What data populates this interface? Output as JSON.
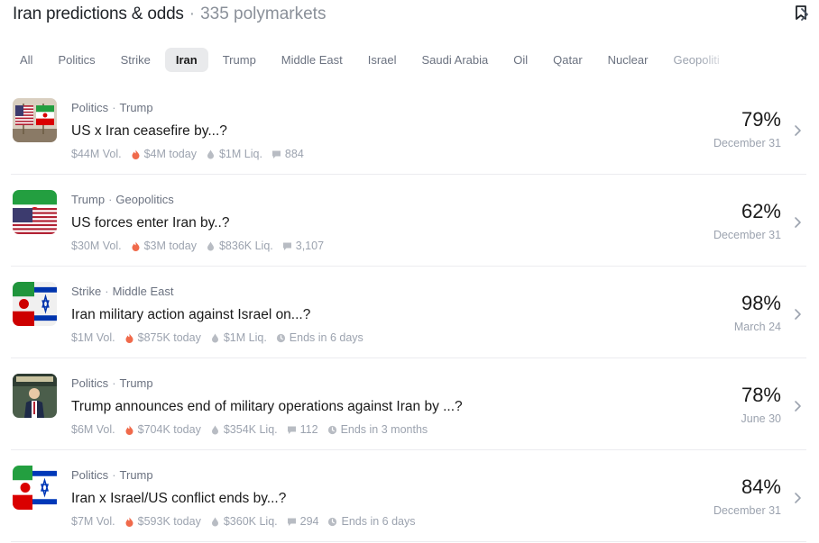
{
  "header": {
    "title": "Iran predictions & odds",
    "separator": "·",
    "count": "335 polymarkets"
  },
  "filters": [
    "All",
    "Politics",
    "Strike",
    "Iran",
    "Trump",
    "Middle East",
    "Israel",
    "Saudi Arabia",
    "Oil",
    "Qatar",
    "Nuclear",
    "Geopoliti"
  ],
  "active_filter": "Iran",
  "markets": [
    {
      "cat1": "Politics",
      "cat2": "Trump",
      "question": "US x Iran ceasefire by...?",
      "vol": "$44M Vol.",
      "today": "$4M today",
      "liq": "$1M Liq.",
      "comments": "884",
      "ends": "",
      "percent": "79%",
      "date": "December 31",
      "thumb": "us-iran-flags"
    },
    {
      "cat1": "Trump",
      "cat2": "Geopolitics",
      "question": "US forces enter Iran by..?",
      "vol": "$30M Vol.",
      "today": "$3M today",
      "liq": "$836K Liq.",
      "comments": "3,107",
      "ends": "",
      "percent": "62%",
      "date": "December 31",
      "thumb": "us-iran-split-flags"
    },
    {
      "cat1": "Strike",
      "cat2": "Middle East",
      "question": "Iran military action against Israel on...?",
      "vol": "$1M Vol.",
      "today": "$875K today",
      "liq": "$1M Liq.",
      "comments": "",
      "ends": "Ends in 6 days",
      "percent": "98%",
      "date": "March 24",
      "thumb": "iran-israel-flags"
    },
    {
      "cat1": "Politics",
      "cat2": "Trump",
      "question": "Trump announces end of military operations against Iran by ...?",
      "vol": "$6M Vol.",
      "today": "$704K today",
      "liq": "$354K Liq.",
      "comments": "112",
      "ends": "Ends in 3 months",
      "percent": "78%",
      "date": "June 30",
      "thumb": "trump-podium"
    },
    {
      "cat1": "Politics",
      "cat2": "Trump",
      "question": "Iran x Israel/US conflict ends by...?",
      "vol": "$7M Vol.",
      "today": "$593K today",
      "liq": "$360K Liq.",
      "comments": "294",
      "ends": "Ends in 6 days",
      "percent": "84%",
      "date": "December 31",
      "thumb": "iran-israel-us-flags"
    }
  ],
  "colors": {
    "flame": "#f06a4b",
    "muted": "#9ca3af",
    "text": "#1a1a1a",
    "active_chip_bg": "#e9eaec"
  }
}
